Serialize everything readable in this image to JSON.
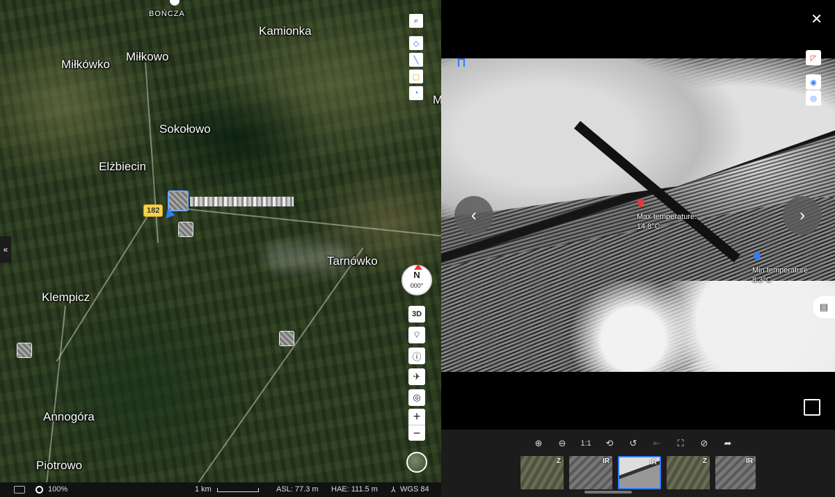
{
  "map": {
    "places": {
      "boncza": "BOŃCZA",
      "kamionka": "Kamionka",
      "milkowo": "Miłkowo",
      "milkowko": "Miłkówko",
      "sokolowo": "Sokołowo",
      "elzbiecin": "Elżbiecin",
      "tarnowko": "Tarnówko",
      "klempicz": "Klempicz",
      "annogora": "Annogóra",
      "piotrowo": "Piotrowo",
      "edge_m": "M"
    },
    "road_number": "182",
    "compass": {
      "letter": "N",
      "heading": "000°"
    },
    "controls": {
      "view_3d": "3D",
      "zoom_in": "+",
      "zoom_out": "−"
    },
    "collapse_label": "«"
  },
  "status_bar": {
    "zoom_percent": "100%",
    "scale": "1 km",
    "asl": "ASL: 77.3 m",
    "hae": "HAE: 111.5 m",
    "datum": "WGS 84"
  },
  "viewer": {
    "close_label": "✕",
    "prev_label": "‹",
    "next_label": "›",
    "max_temp": {
      "label": "Max temperature:",
      "value": "14.8°C",
      "color": "#e53935"
    },
    "min_temp": {
      "label": "Min temperature:",
      "value": "8.3°C",
      "color": "#2f7dff"
    },
    "toolbar": {
      "ratio_label": "1:1"
    },
    "thumbnails": [
      {
        "tag": "Z"
      },
      {
        "tag": "IR"
      },
      {
        "tag": "IR"
      },
      {
        "tag": "Z"
      },
      {
        "tag": "IR"
      }
    ]
  },
  "colors": {
    "accent": "#2f7dff",
    "road_badge": "#f6d24a"
  }
}
